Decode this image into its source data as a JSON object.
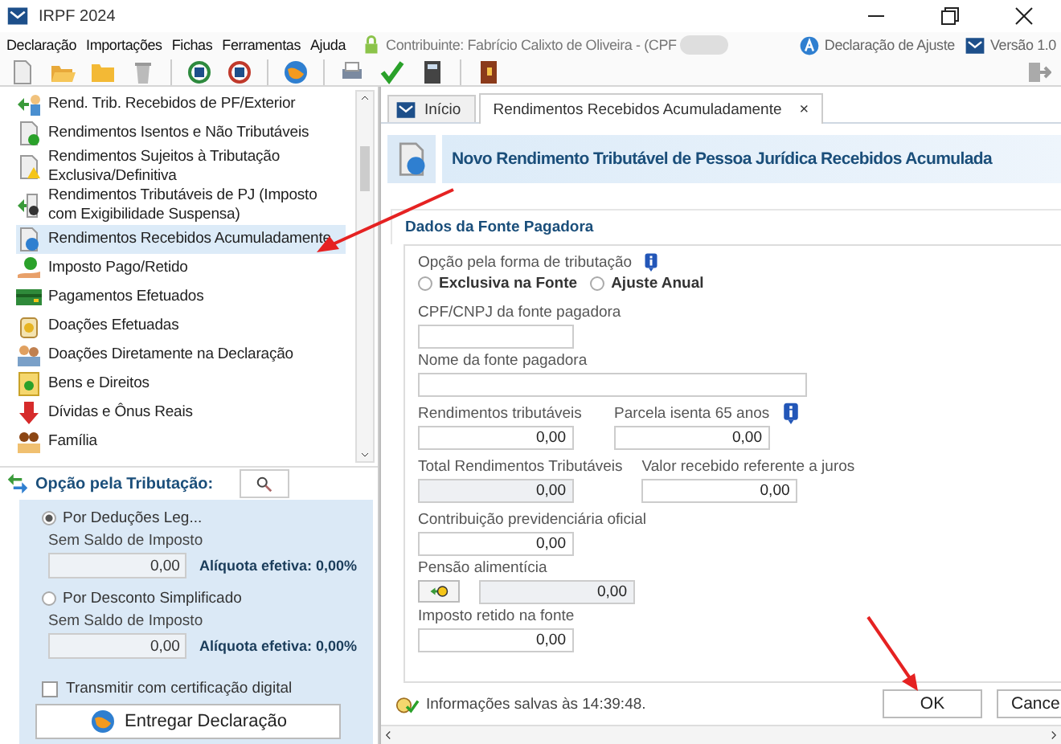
{
  "window": {
    "title": "IRPF 2024"
  },
  "menu": [
    "Declaração",
    "Importações",
    "Fichas",
    "Ferramentas",
    "Ajuda"
  ],
  "contributor": "Contribuinte: Fabrício Calixto de Oliveira - (CPF",
  "declaration_type": "Declaração de Ajuste",
  "version": "Versão 1.0",
  "sidebar": {
    "items": [
      {
        "label": "Rend. Trib. Recebidos de PF/Exterior",
        "selected": false
      },
      {
        "label": "Rendimentos Isentos e Não Tributáveis",
        "selected": false
      },
      {
        "label": "Rendimentos Sujeitos à Tributação Exclusiva/Definitiva",
        "selected": false
      },
      {
        "label": "Rendimentos Tributáveis de PJ (Imposto com Exigibilidade Suspensa)",
        "selected": false
      },
      {
        "label": "Rendimentos Recebidos Acumuladamente",
        "selected": true
      },
      {
        "label": "Imposto Pago/Retido",
        "selected": false
      },
      {
        "label": "Pagamentos Efetuados",
        "selected": false
      },
      {
        "label": "Doações Efetuadas",
        "selected": false
      },
      {
        "label": "Doações Diretamente na Declaração",
        "selected": false
      },
      {
        "label": "Bens e Direitos",
        "selected": false
      },
      {
        "label": "Dívidas e Ônus Reais",
        "selected": false
      },
      {
        "label": "Família",
        "selected": false
      }
    ]
  },
  "tax_option": {
    "title": "Opção pela Tributação:",
    "options": [
      {
        "label": "Por Deduções Leg...",
        "selected": true,
        "caption": "Sem Saldo de Imposto",
        "value": "0,00",
        "rate": "Alíquota efetiva: 0,00%"
      },
      {
        "label": "Por Desconto Simplificado",
        "selected": false,
        "caption": "Sem Saldo de Imposto",
        "value": "0,00",
        "rate": "Alíquota efetiva: 0,00%"
      }
    ],
    "digital_certificate": {
      "label": "Transmitir com certificação digital",
      "checked": false
    },
    "submit_button": "Entregar Declaração"
  },
  "tabs": [
    {
      "label": "Início",
      "selected": false
    },
    {
      "label": "Rendimentos Recebidos Acumuladamente",
      "selected": true,
      "close": "×"
    }
  ],
  "form": {
    "title": "Novo Rendimento Tributável de Pessoa Jurídica Recebidos Acumulada",
    "section": "Dados da Fonte Pagadora",
    "taxation_label": "Opção pela forma de tributação",
    "taxation_options": [
      {
        "label": "Exclusiva na Fonte",
        "selected": false
      },
      {
        "label": "Ajuste Anual",
        "selected": false
      }
    ],
    "rows": [
      [
        {
          "label": "CPF/CNPJ da fonte pagadora",
          "readonly": false
        }
      ],
      [
        {
          "label": "Nome da fonte pagadora",
          "readonly": false,
          "wide": true
        }
      ],
      [
        {
          "label": "Rendimentos tributáveis",
          "value": "0,00",
          "readonly": false
        },
        {
          "label": "Parcela isenta 65 anos",
          "value": "0,00",
          "readonly": false,
          "info": true
        }
      ],
      [
        {
          "label": "Total Rendimentos Tributáveis",
          "value": "0,00",
          "readonly": true
        },
        {
          "label": "Valor recebido referente a juros",
          "value": "0,00",
          "readonly": false
        }
      ],
      [
        {
          "label": "Contribuição previdenciária oficial",
          "value": "0,00",
          "readonly": false
        }
      ],
      [
        {
          "label": "Pensão alimentícia",
          "value": "0,00",
          "readonly": true,
          "button": true
        }
      ],
      [
        {
          "label": "Imposto retido na fonte",
          "value": "0,00",
          "readonly": false
        }
      ]
    ]
  },
  "status": "Informações salvas às 14:39:48.",
  "buttons": [
    "OK",
    "Cance"
  ]
}
